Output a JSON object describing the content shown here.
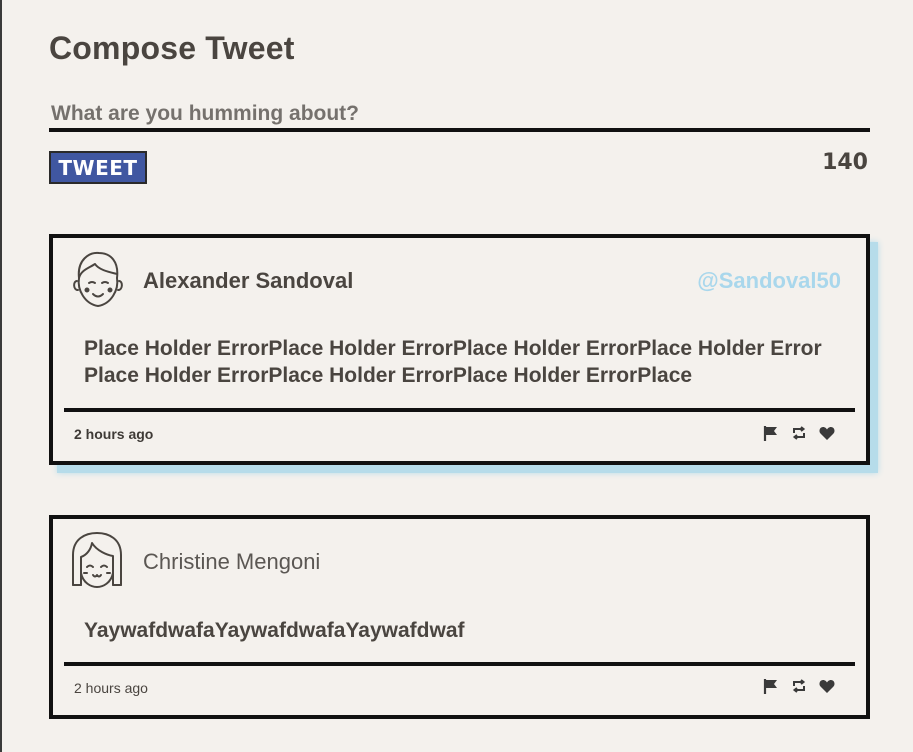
{
  "compose": {
    "title": "Compose Tweet",
    "placeholder": "What are you humming about?",
    "value": "",
    "button_label": "TWEET",
    "char_count": "140"
  },
  "tweets": [
    {
      "author": "Alexander Sandoval",
      "handle": "@Sandoval50",
      "text": "Place Holder ErrorPlace Holder ErrorPlace Holder ErrorPlace Holder ErrorPlace Holder ErrorPlace Holder ErrorPlace Holder ErrorPlace",
      "timestamp": "2 hours ago",
      "avatar": "boy-avatar-icon",
      "highlighted": true
    },
    {
      "author": "Christine Mengoni",
      "handle": "",
      "text": "YaywafdwafaYaywafdwafaYaywafdwaf",
      "timestamp": "2 hours ago",
      "avatar": "girl-avatar-icon",
      "highlighted": false
    }
  ],
  "actions": {
    "flag": "flag-icon",
    "retweet": "retweet-icon",
    "like": "heart-icon"
  },
  "colors": {
    "background": "#f4f1ed",
    "button": "#4057a1",
    "handle": "#a9d7ec",
    "highlight_shadow": "#b6dcea",
    "text": "#4a4540"
  }
}
